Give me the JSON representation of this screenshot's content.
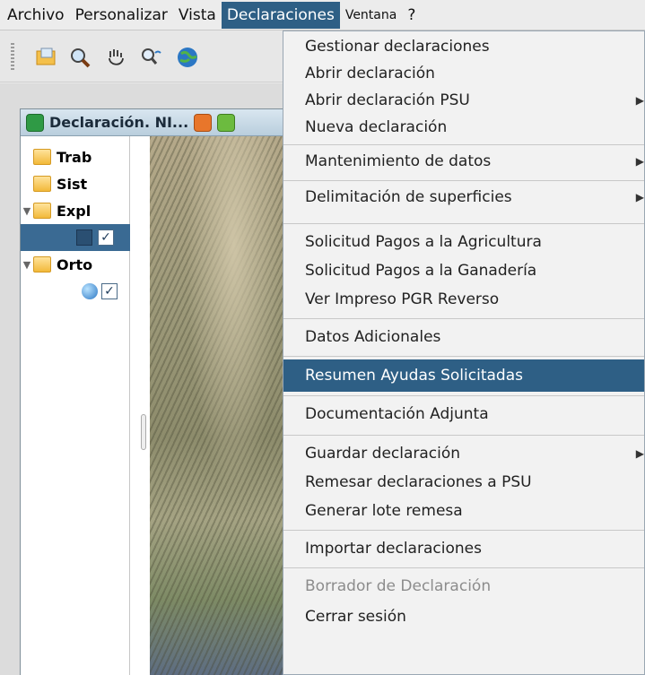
{
  "menubar": {
    "items": [
      "Archivo",
      "Personalizar",
      "Vista",
      "Declaraciones",
      "Ventana",
      "?"
    ]
  },
  "toolbar": {
    "icons": [
      "open-icon",
      "search-icon",
      "hand-icon",
      "identify-icon",
      "globe-icon"
    ]
  },
  "window": {
    "title": "Declaración. NI..."
  },
  "tree": {
    "items": [
      "Trab",
      "Sist",
      "Expl",
      "",
      "Orto",
      ""
    ]
  },
  "declaraciones_menu": {
    "items": [
      "Gestionar declaraciones",
      "Abrir declaración",
      "Abrir declaración PSU",
      "Nueva declaración",
      "Mantenimiento de datos",
      "Delimitación de superficies",
      "Solicitud Pagos a la Agricultura",
      "Solicitud Pagos a la Ganadería",
      "Ver Impreso PGR Reverso",
      "Datos Adicionales",
      "Resumen Ayudas Solicitadas",
      "Documentación Adjunta",
      "Guardar declaración",
      "Remesar declaraciones a PSU",
      "Generar lote remesa",
      "Importar declaraciones",
      "Borrador de Declaración",
      "Cerrar sesión"
    ]
  },
  "colors": {
    "highlight": "#2e5f85",
    "menu_bg": "#f2f2f2",
    "disabled_text": "#8c8c8c"
  }
}
